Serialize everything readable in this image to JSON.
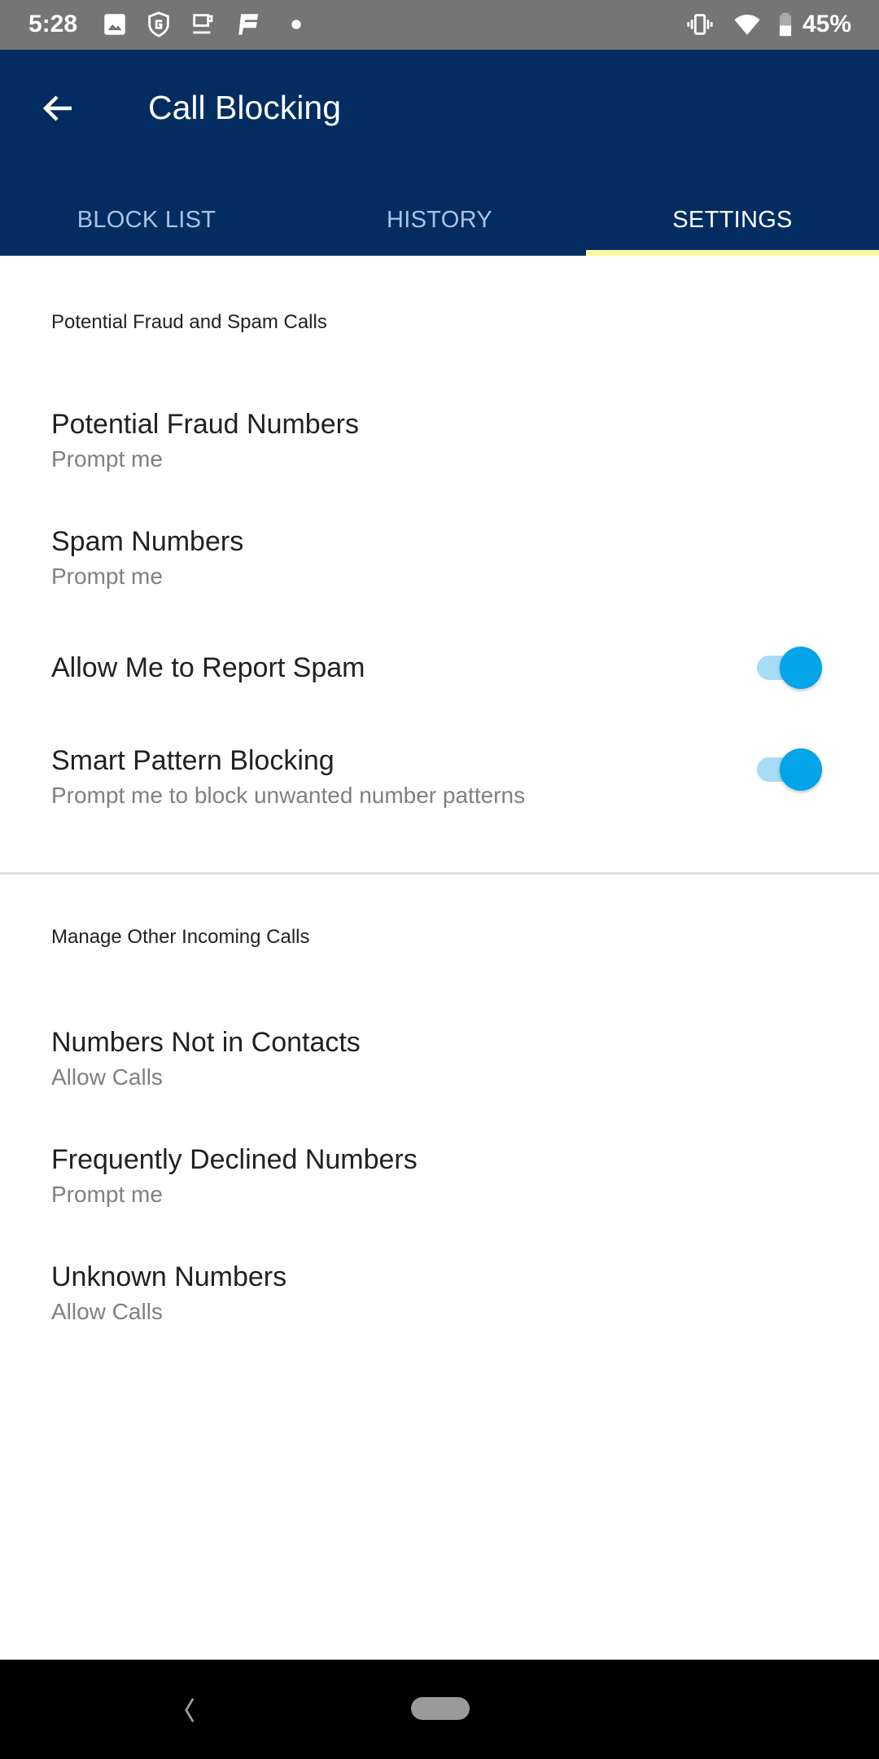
{
  "status_bar": {
    "time": "5:28",
    "left_icons": [
      "image-icon",
      "shield-g-icon",
      "coffee-cup-icon",
      "app-e-icon",
      "dot-icon"
    ],
    "right_icons": [
      "vibrate-icon",
      "wifi-icon",
      "battery-icon"
    ],
    "battery_percent": "45%"
  },
  "app_bar": {
    "title": "Call Blocking",
    "back_icon": "arrow-left-icon",
    "background_color": "#032d60"
  },
  "tabs": [
    {
      "label": "BLOCK LIST",
      "active": false
    },
    {
      "label": "HISTORY",
      "active": false
    },
    {
      "label": "SETTINGS",
      "active": true
    }
  ],
  "tab_indicator_color": "#fbf8a0",
  "sections": [
    {
      "header": "Potential Fraud and Spam Calls",
      "items": [
        {
          "title": "Potential Fraud Numbers",
          "subtitle": "Prompt me"
        },
        {
          "title": "Spam Numbers",
          "subtitle": "Prompt me"
        },
        {
          "title": "Allow Me to Report Spam",
          "toggle": true
        },
        {
          "title": "Smart Pattern Blocking",
          "subtitle": "Prompt me to block unwanted number patterns",
          "toggle": true
        }
      ]
    },
    {
      "header": "Manage Other Incoming Calls",
      "items": [
        {
          "title": "Numbers Not in Contacts",
          "subtitle": "Allow Calls"
        },
        {
          "title": "Frequently Declined Numbers",
          "subtitle": "Prompt me"
        },
        {
          "title": "Unknown Numbers",
          "subtitle": "Allow Calls"
        }
      ]
    }
  ],
  "toggle_color": "#03a4e8",
  "nav_bar": {
    "buttons": [
      "back-icon",
      "home-pill-icon"
    ]
  }
}
